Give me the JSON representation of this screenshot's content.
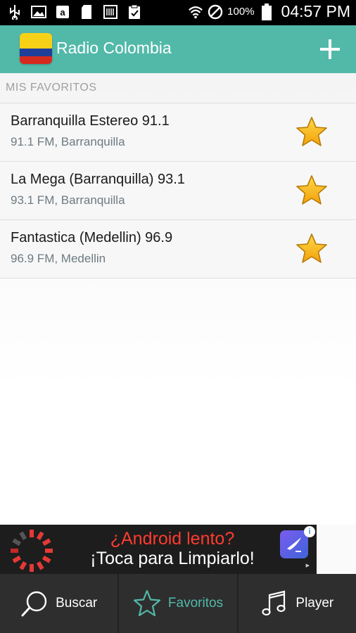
{
  "status_bar": {
    "battery_percent": "100%",
    "clock": "04:57 PM",
    "icons": [
      "usb-icon",
      "image-icon",
      "amazon-icon",
      "sd-card-icon",
      "barcode-icon",
      "clipboard-icon",
      "wifi-icon",
      "do-not-disturb-icon",
      "battery-icon"
    ]
  },
  "app_bar": {
    "title": "Radio Colombia",
    "add_icon": "plus-icon",
    "accent_color": "#52b9a9"
  },
  "favorites": {
    "section_title": "MIS FAVORITOS",
    "items": [
      {
        "title": "Barranquilla Estereo 91.1",
        "subtitle": "91.1 FM, Barranquilla"
      },
      {
        "title": "La Mega (Barranquilla) 93.1",
        "subtitle": "93.1 FM, Barranquilla"
      },
      {
        "title": "Fantastica (Medellin) 96.9",
        "subtitle": "96.9 FM, Medellin"
      }
    ]
  },
  "ad": {
    "line1": "¿Android lento?",
    "line2": "¡Toca para Limpiarlo!",
    "info_glyph": "i"
  },
  "bottom_nav": {
    "tabs": [
      {
        "label": "Buscar",
        "icon": "search-icon",
        "active": false
      },
      {
        "label": "Favoritos",
        "icon": "star-outline-icon",
        "active": true
      },
      {
        "label": "Player",
        "icon": "music-note-icon",
        "active": false
      }
    ],
    "active_color": "#52b9a9",
    "inactive_color": "#ffffff"
  }
}
